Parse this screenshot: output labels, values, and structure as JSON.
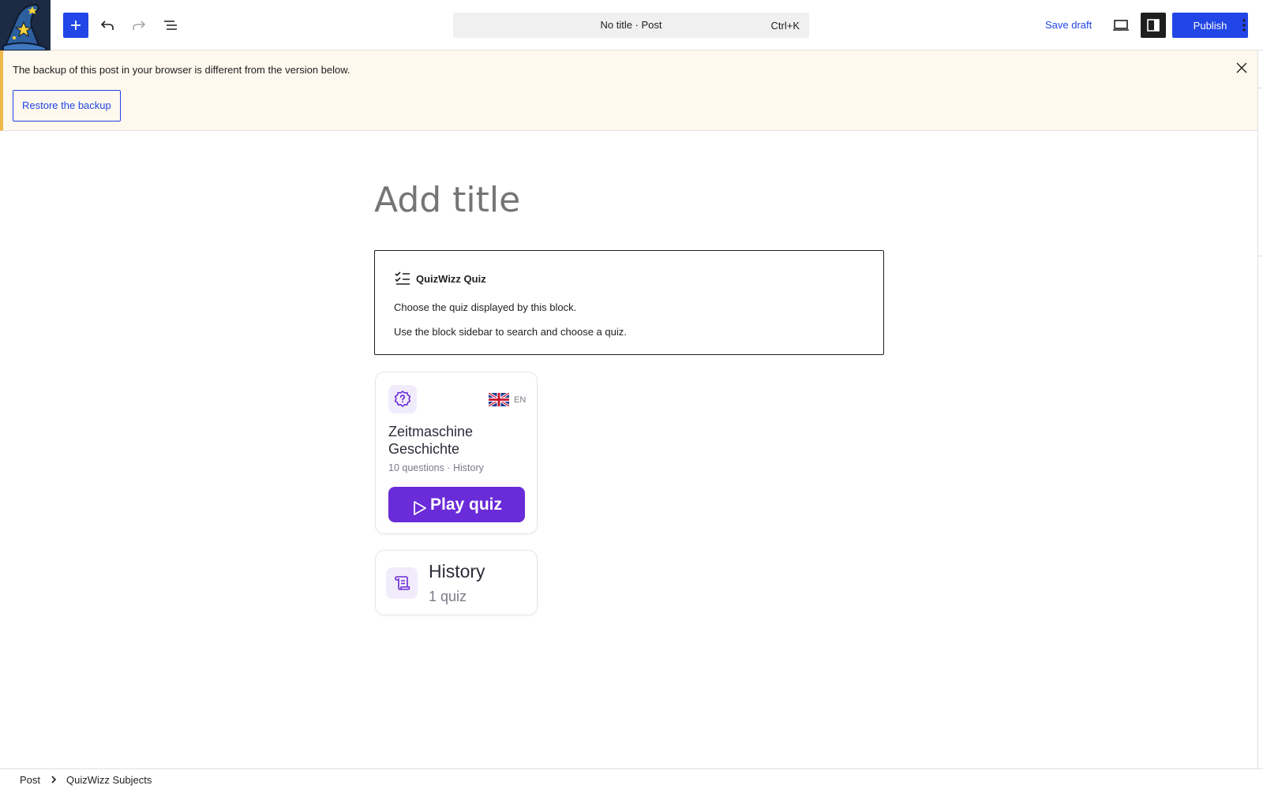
{
  "header": {
    "logo_icon": "wizard-hat-icon",
    "command_bar": {
      "title": "No title · Post",
      "shortcut": "Ctrl+K"
    },
    "save_draft_label": "Save draft",
    "publish_label": "Publish",
    "accent_color": "#2145e6"
  },
  "notice": {
    "message": "The backup of this post in your browser is different from the version below.",
    "restore_label": "Restore the backup",
    "border_color": "#f0b849"
  },
  "editor": {
    "title_placeholder": "Add title",
    "quiz_block": {
      "title": "QuizWizz Quiz",
      "line1": "Choose the quiz displayed by this block.",
      "line2": "Use the block sidebar to search and choose a quiz."
    },
    "quiz_card": {
      "language_code": "EN",
      "name": "Zeitmaschine Geschichte",
      "meta": "10 questions · History",
      "play_label": "Play quiz",
      "accent_color": "#6a2bd8"
    },
    "subject_card": {
      "name": "History",
      "count": "1 quiz"
    }
  },
  "footer": {
    "breadcrumbs": [
      "Post",
      "QuizWizz Subjects"
    ]
  }
}
